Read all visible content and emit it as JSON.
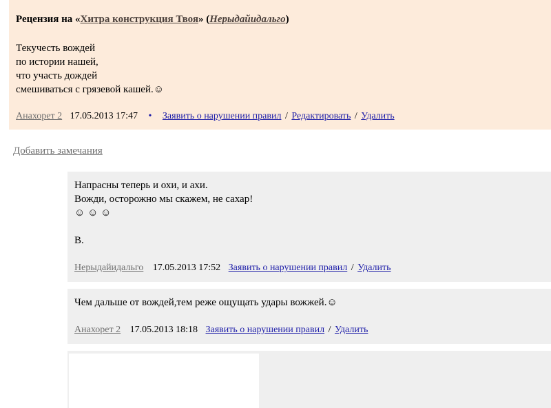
{
  "review": {
    "title_prefix": "Рецензия на «",
    "work_title": "Хитра конструкция Твоя",
    "title_mid": "» (",
    "work_author": "Нерыдайидальго",
    "title_suffix": ")",
    "body": "Текучесть вождей\nпо истории нашей,\nчто участь дождей\nсмешиваться с грязевой кашей.☺",
    "author": "Анахорет 2",
    "date": "17.05.2013 17:47",
    "bullet": "•",
    "report": "Заявить о нарушении правил",
    "sep": "/",
    "edit": "Редактировать",
    "delete": "Удалить"
  },
  "add_remarks": "Добавить замечания",
  "comments": [
    {
      "body": "Напрасны теперь и охи, и ахи.\nВожди, осторожно мы скажем, не сахар!\n☺ ☺ ☺\n\nВ.",
      "author": "Нерыдайидальго",
      "date": "17.05.2013 17:52",
      "report": "Заявить о нарушении правил",
      "sep": "/",
      "delete": "Удалить"
    },
    {
      "body": "Чем дальше от вождей,тем реже ощущать удары вожжей.☺",
      "author": "Анахорет 2",
      "date": "17.05.2013 18:18",
      "report": "Заявить о нарушении правил",
      "sep": "/",
      "delete": "Удалить"
    }
  ]
}
